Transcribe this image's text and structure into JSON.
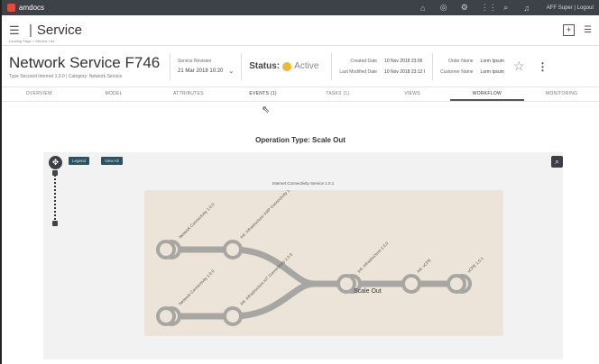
{
  "topbar": {
    "brand": "amdocs",
    "user_text": "AFF Super | Logout",
    "icons": [
      "home-icon",
      "help-icon",
      "settings-icon",
      "apps-icon",
      "search-icon",
      "bell-icon"
    ]
  },
  "header": {
    "title": "Service",
    "breadcrumb": "Landing Page  >  Service List"
  },
  "service": {
    "name": "Network Service F746",
    "subtitle": "Type Secured Internet 1.0.0  |  Category: Network Service",
    "revision_label": "Service Revision",
    "revision_value": "21 Mar 2018  10:20",
    "status_label": "Status:",
    "status_value": "Active",
    "status_color": "#f2b630",
    "created_label": "Created Date",
    "created_value": "10 Nov 2018 23:06",
    "modified_label": "Last Modified Date",
    "modified_value": "10 Nov 2018 23:12 I",
    "order_label": "Order Name",
    "order_value": "Lorm Ipsum",
    "customer_label": "Customer Name",
    "customer_value": "Lorm Ipsum"
  },
  "tabs": [
    {
      "label": "OVERVIEW"
    },
    {
      "label": "MODEL"
    },
    {
      "label": "ATTRIBUTES"
    },
    {
      "label": "EVENTS (1)"
    },
    {
      "label": "TASKS (1)"
    },
    {
      "label": "VIEWS"
    },
    {
      "label": "WORKFLOW"
    },
    {
      "label": "MONITORING"
    }
  ],
  "workflow": {
    "operation_type": "Operation Type: Scale Out",
    "legend_button": "Legend",
    "view_all_button": "View All",
    "service_title": "Internet Connectivity Service 1.0.1",
    "nodes": {
      "n1": "Network Connectivity 1.0.0",
      "n2": "Intl. Infrastructure VoIP Connectivity 1.0.0",
      "n3": "Network Connectivity 1.0.0",
      "n4": "Intl. Infrastructure IoT Connectivity 1.0.0",
      "n5": "Intl. Infrastructure 1.0.0",
      "n6": "Intl. vCPE",
      "n7": "vCPE 1.0.1"
    },
    "node_label_scale": "Scale Out"
  }
}
